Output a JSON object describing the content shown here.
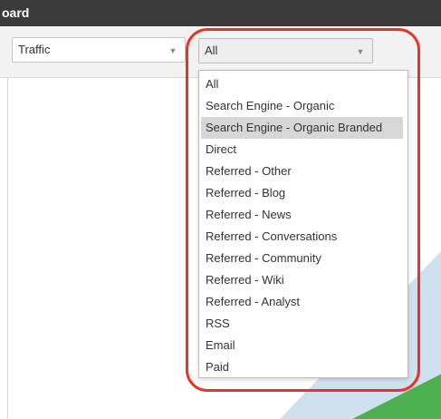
{
  "window": {
    "title": "oard"
  },
  "filters": {
    "traffic_select": {
      "value": "Traffic",
      "caret": "chevron-down-icon"
    },
    "source_select": {
      "value": "All",
      "caret": "chevron-down-icon",
      "open": true
    }
  },
  "dropdown": {
    "options": [
      {
        "label": "All"
      },
      {
        "label": "Search Engine - Organic"
      },
      {
        "label": "Search Engine - Organic Branded",
        "highlighted": true
      },
      {
        "label": "Direct"
      },
      {
        "label": "Referred - Other"
      },
      {
        "label": "Referred - Blog"
      },
      {
        "label": "Referred - News"
      },
      {
        "label": "Referred - Conversations"
      },
      {
        "label": "Referred - Community"
      },
      {
        "label": "Referred - Wiki"
      },
      {
        "label": "Referred - Analyst"
      },
      {
        "label": "RSS"
      },
      {
        "label": "Email"
      },
      {
        "label": "Paid"
      }
    ]
  },
  "colors": {
    "title_bar": "#3b3b3b",
    "highlight": "#d7d7d7",
    "annotation": "#e8332a",
    "shape_blue": "#cfe0ee",
    "shape_green": "#4caf50"
  }
}
